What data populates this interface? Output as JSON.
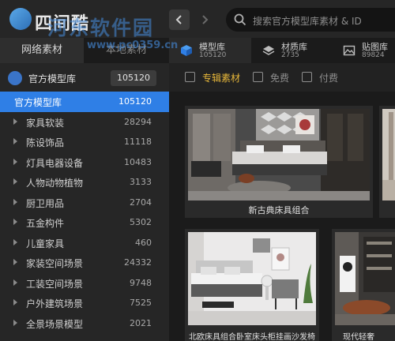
{
  "app": {
    "logo_text": "四间酷",
    "watermark_text": "河东软件园",
    "watermark_url": "www.pc0359.cn"
  },
  "search": {
    "placeholder": "搜索官方模型库素材 & ID"
  },
  "sidebar": {
    "tabs": [
      {
        "label": "网络素材",
        "active": true
      },
      {
        "label": "本地素材",
        "active": false
      }
    ],
    "library": {
      "title": "官方模型库",
      "count": "105120"
    },
    "categories": [
      {
        "label": "官方模型库",
        "count": "105120",
        "selected": true
      },
      {
        "label": "家具软装",
        "count": "28294"
      },
      {
        "label": "陈设饰品",
        "count": "11118"
      },
      {
        "label": "灯具电器设备",
        "count": "10483"
      },
      {
        "label": "人物动物植物",
        "count": "3133"
      },
      {
        "label": "厨卫用品",
        "count": "2704"
      },
      {
        "label": "五金构件",
        "count": "5302"
      },
      {
        "label": "儿童家具",
        "count": "460"
      },
      {
        "label": "家装空间场景",
        "count": "24332"
      },
      {
        "label": "工装空间场景",
        "count": "9748"
      },
      {
        "label": "户外建筑场景",
        "count": "7525"
      },
      {
        "label": "全景场景模型",
        "count": "2021"
      }
    ]
  },
  "content_tabs": [
    {
      "label": "模型库",
      "count": "105120",
      "icon": "cube-icon",
      "active": true
    },
    {
      "label": "材质库",
      "count": "2735",
      "icon": "layers-icon",
      "active": false
    },
    {
      "label": "贴图库",
      "count": "89824",
      "icon": "image-icon",
      "active": false
    }
  ],
  "filters": [
    {
      "label": "专辑素材",
      "checked": false,
      "accent": true
    },
    {
      "label": "免费",
      "checked": false
    },
    {
      "label": "付费",
      "checked": false
    }
  ],
  "cards": [
    {
      "title": "新古典床具组合"
    },
    {
      "title": ""
    },
    {
      "title": "北欧床具组合卧室床头柜挂画沙发椅"
    },
    {
      "title": "现代轻奢"
    }
  ],
  "colors": {
    "accent": "#2f7fe6",
    "filter_accent": "#e8b83a",
    "bg": "#1e1e1e"
  }
}
